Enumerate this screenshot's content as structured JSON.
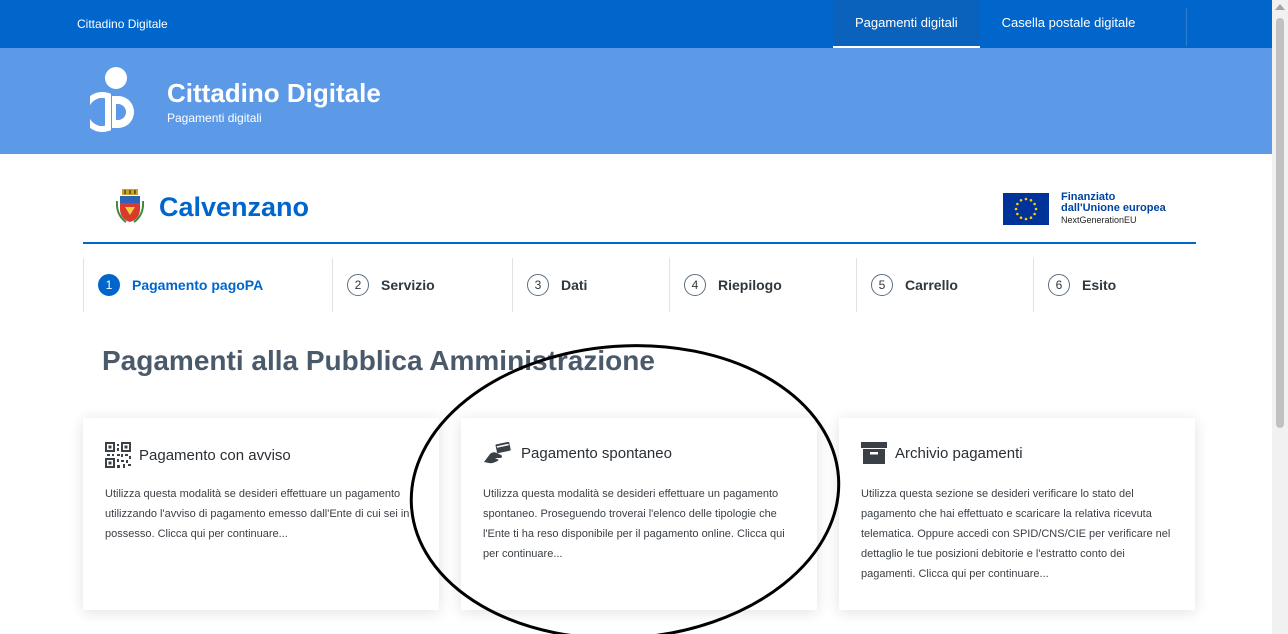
{
  "topbar": {
    "brand": "Cittadino Digitale",
    "nav": [
      {
        "label": "Pagamenti digitali"
      },
      {
        "label": "Casella postale digitale"
      }
    ]
  },
  "header": {
    "title": "Cittadino Digitale",
    "subtitle": "Pagamenti digitali"
  },
  "entity": {
    "name": "Calvenzano",
    "eu": {
      "line1": "Finanziato",
      "line2": "dall'Unione europea",
      "line3": "NextGenerationEU"
    }
  },
  "steps": [
    {
      "num": "1",
      "label": "Pagamento pagoPA"
    },
    {
      "num": "2",
      "label": "Servizio"
    },
    {
      "num": "3",
      "label": "Dati"
    },
    {
      "num": "4",
      "label": "Riepilogo"
    },
    {
      "num": "5",
      "label": "Carrello"
    },
    {
      "num": "6",
      "label": "Esito"
    }
  ],
  "main": {
    "title": "Pagamenti alla Pubblica Amministrazione"
  },
  "cards": [
    {
      "icon": "qr-code-icon",
      "title": "Pagamento con avviso",
      "desc": "Utilizza questa modalità se desideri effettuare un pagamento utilizzando l'avviso di pagamento emesso dall'Ente di cui sei in possesso. Clicca qui per continuare..."
    },
    {
      "icon": "hand-card-icon",
      "title": "Pagamento spontaneo",
      "desc": "Utilizza questa modalità se desideri effettuare un pagamento spontaneo. Proseguendo troverai l'elenco delle tipologie che l'Ente ti ha reso disponibile per il pagamento online. Clicca qui per continuare..."
    },
    {
      "icon": "archive-box-icon",
      "title": "Archivio pagamenti",
      "desc": "Utilizza questa sezione se desideri verificare lo stato del pagamento che hai effettuato e scaricare la relativa ricevuta telematica. Oppure accedi con SPID/CNS/CIE per verificare nel dettaglio le tue posizioni debitorie e l'estratto conto dei pagamenti. Clicca qui per continuare..."
    }
  ],
  "colors": {
    "primary": "#0066cc",
    "header_bg": "#5c9ae8",
    "annotation": "#000000"
  }
}
